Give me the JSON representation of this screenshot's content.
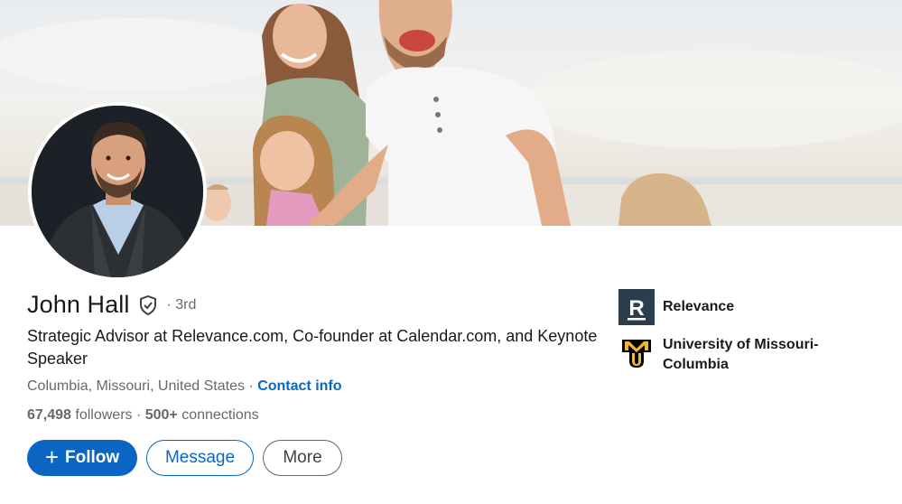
{
  "profile": {
    "name": "John Hall",
    "degree": "· 3rd",
    "headline": "Strategic Advisor at Relevance.com, Co-founder at Calendar.com, and Keynote Speaker",
    "location": "Columbia, Missouri, United States",
    "separator": " · ",
    "contact_info": "Contact info",
    "followers_count": "67,498",
    "followers_label": " followers",
    "connections_sep": " · ",
    "connections_count": "500+",
    "connections_label": " connections"
  },
  "actions": {
    "follow_icon": "+",
    "follow_label": "Follow",
    "message_label": "Message",
    "more_label": "More"
  },
  "organizations": [
    {
      "name": "Relevance",
      "logo": "relevance-logo",
      "logo_letter": "R"
    },
    {
      "name": "University of Missouri-Columbia",
      "logo": "mizzou-logo",
      "logo_letters": "MU"
    }
  ],
  "icons": {
    "verified": "shield-check-icon"
  },
  "colors": {
    "accent": "#0a66c2",
    "relevance_logo_bg": "#2b3e4e",
    "mizzou_gold": "#f1b82d"
  }
}
